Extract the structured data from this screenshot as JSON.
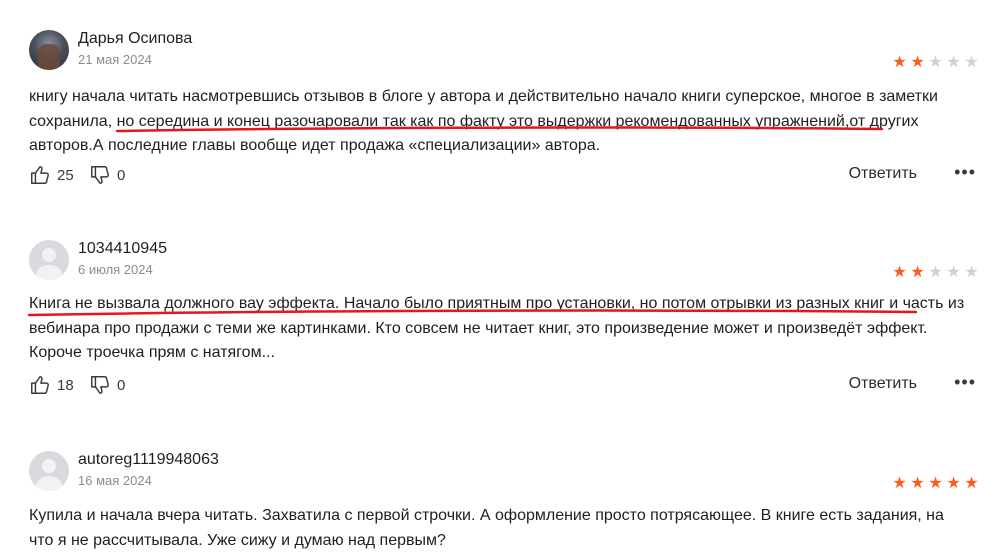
{
  "reviews": [
    {
      "author": "Дарья Осипова",
      "date": "21 мая 2024",
      "rating": 2,
      "text_1": "книгу начала читать насмотревшись отзывов в блоге у автора и действительно начало книги суперское, многое в заметки сохранила, ",
      "text_2": "но середина и конец разочаровали так как по факту это выдержки рекомендованных упражнений",
      "text_3": ",от других авторов.А последние главы вообще идет продажа «специализации» автора.",
      "likes": "25",
      "dislikes": "0",
      "reply_label": "Ответить",
      "more_label": "•••"
    },
    {
      "author": "1034410945",
      "date": "6 июля 2024",
      "rating": 2,
      "text_1": "Книга не вызвала должного вау эффекта. Начало было приятным про установки, но потом отрывки из разных книг и часть из вебинара про продажи с теми же картинками. Кто совсем не читает книг, это произведение может и произведёт эффект. Короче троечка прям с натягом...",
      "likes": "18",
      "dislikes": "0",
      "reply_label": "Ответить",
      "more_label": "•••"
    },
    {
      "author": "autoreg1119948063",
      "date": "16 мая 2024",
      "rating": 5,
      "text_1": "Купила и начала вчера читать. Захватила с первой строчки. А оформление просто потрясающее. В книге есть задания, на что я не рассчитывала. Уже сижу и думаю над первым?"
    }
  ],
  "colors": {
    "star_on": "#ff5c1a",
    "star_off": "#d0d0d0",
    "annotation": "#e8141e"
  },
  "icons": {
    "like": "thumb-up-icon",
    "dislike": "thumb-down-icon",
    "more": "ellipsis-icon"
  }
}
